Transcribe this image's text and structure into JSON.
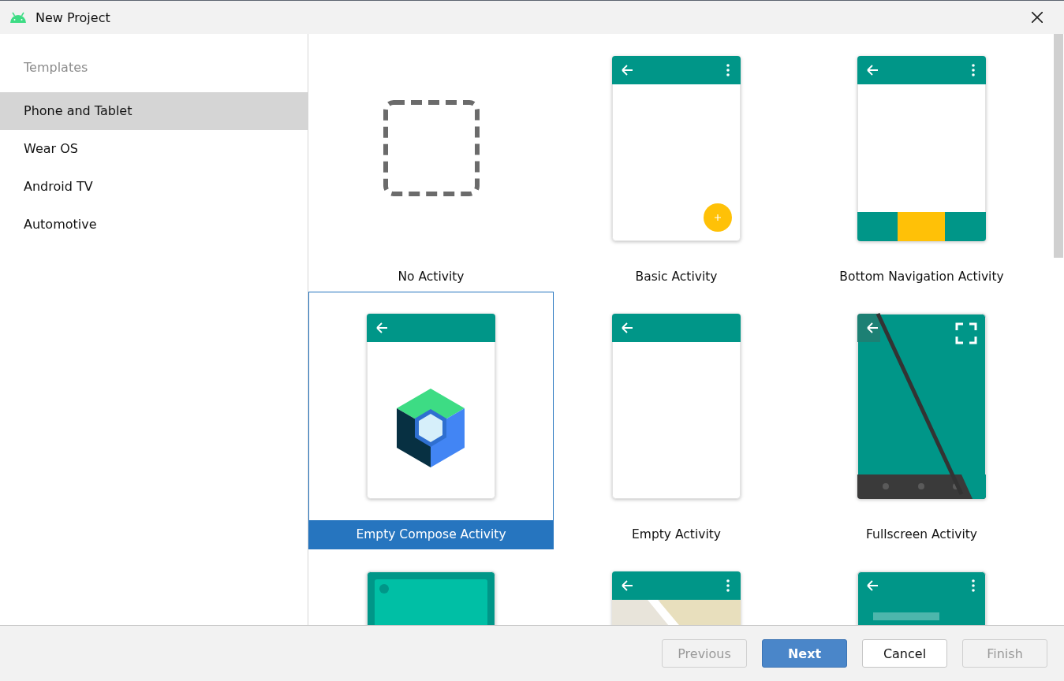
{
  "window": {
    "title": "New Project"
  },
  "sidebar": {
    "heading": "Templates",
    "items": [
      {
        "label": "Phone and Tablet",
        "selected": true
      },
      {
        "label": "Wear OS",
        "selected": false
      },
      {
        "label": "Android TV",
        "selected": false
      },
      {
        "label": "Automotive",
        "selected": false
      }
    ]
  },
  "templates": [
    {
      "kind": "none",
      "label": "No Activity",
      "selected": false
    },
    {
      "kind": "basic",
      "label": "Basic Activity",
      "selected": false
    },
    {
      "kind": "bottom_nav",
      "label": "Bottom Navigation Activity",
      "selected": false
    },
    {
      "kind": "compose",
      "label": "Empty Compose Activity",
      "selected": true
    },
    {
      "kind": "empty",
      "label": "Empty Activity",
      "selected": false
    },
    {
      "kind": "fullscreen",
      "label": "Fullscreen Activity",
      "selected": false
    },
    {
      "kind": "panel",
      "selected": false
    },
    {
      "kind": "map",
      "selected": false
    },
    {
      "kind": "list_fab",
      "selected": false
    }
  ],
  "buttons": [
    {
      "label": "Previous",
      "kind": "default",
      "disabled": true
    },
    {
      "label": "Next",
      "kind": "primary",
      "disabled": false
    },
    {
      "label": "Cancel",
      "kind": "default",
      "disabled": false
    },
    {
      "label": "Finish",
      "kind": "default",
      "disabled": true
    }
  ]
}
